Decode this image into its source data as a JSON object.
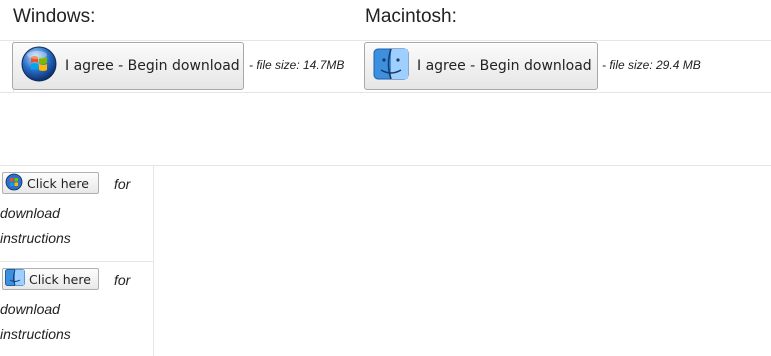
{
  "downloads": {
    "windows": {
      "heading": "Windows:",
      "button_label": "I agree - Begin download",
      "file_size": "- file size: 14.7MB",
      "icon": "windows-logo-icon"
    },
    "mac": {
      "heading": "Macintosh:",
      "button_label": "I agree - Begin download",
      "file_size": "- file size: 29.4 MB",
      "icon": "mac-finder-icon"
    }
  },
  "instructions": {
    "windows": {
      "button_label": "Click here",
      "for_text": "for",
      "line1": "download",
      "line2": "instructions",
      "icon": "windows-logo-icon"
    },
    "mac": {
      "button_label": "Click here",
      "for_text": "for",
      "line1": "download",
      "line2": "instructions",
      "icon": "mac-finder-icon"
    }
  },
  "colors": {
    "border": "#e6e6e6",
    "button_border": "#a8a8a8",
    "windows_orb": "#2a6fc9",
    "mac_finder": "#3d8fe0"
  }
}
